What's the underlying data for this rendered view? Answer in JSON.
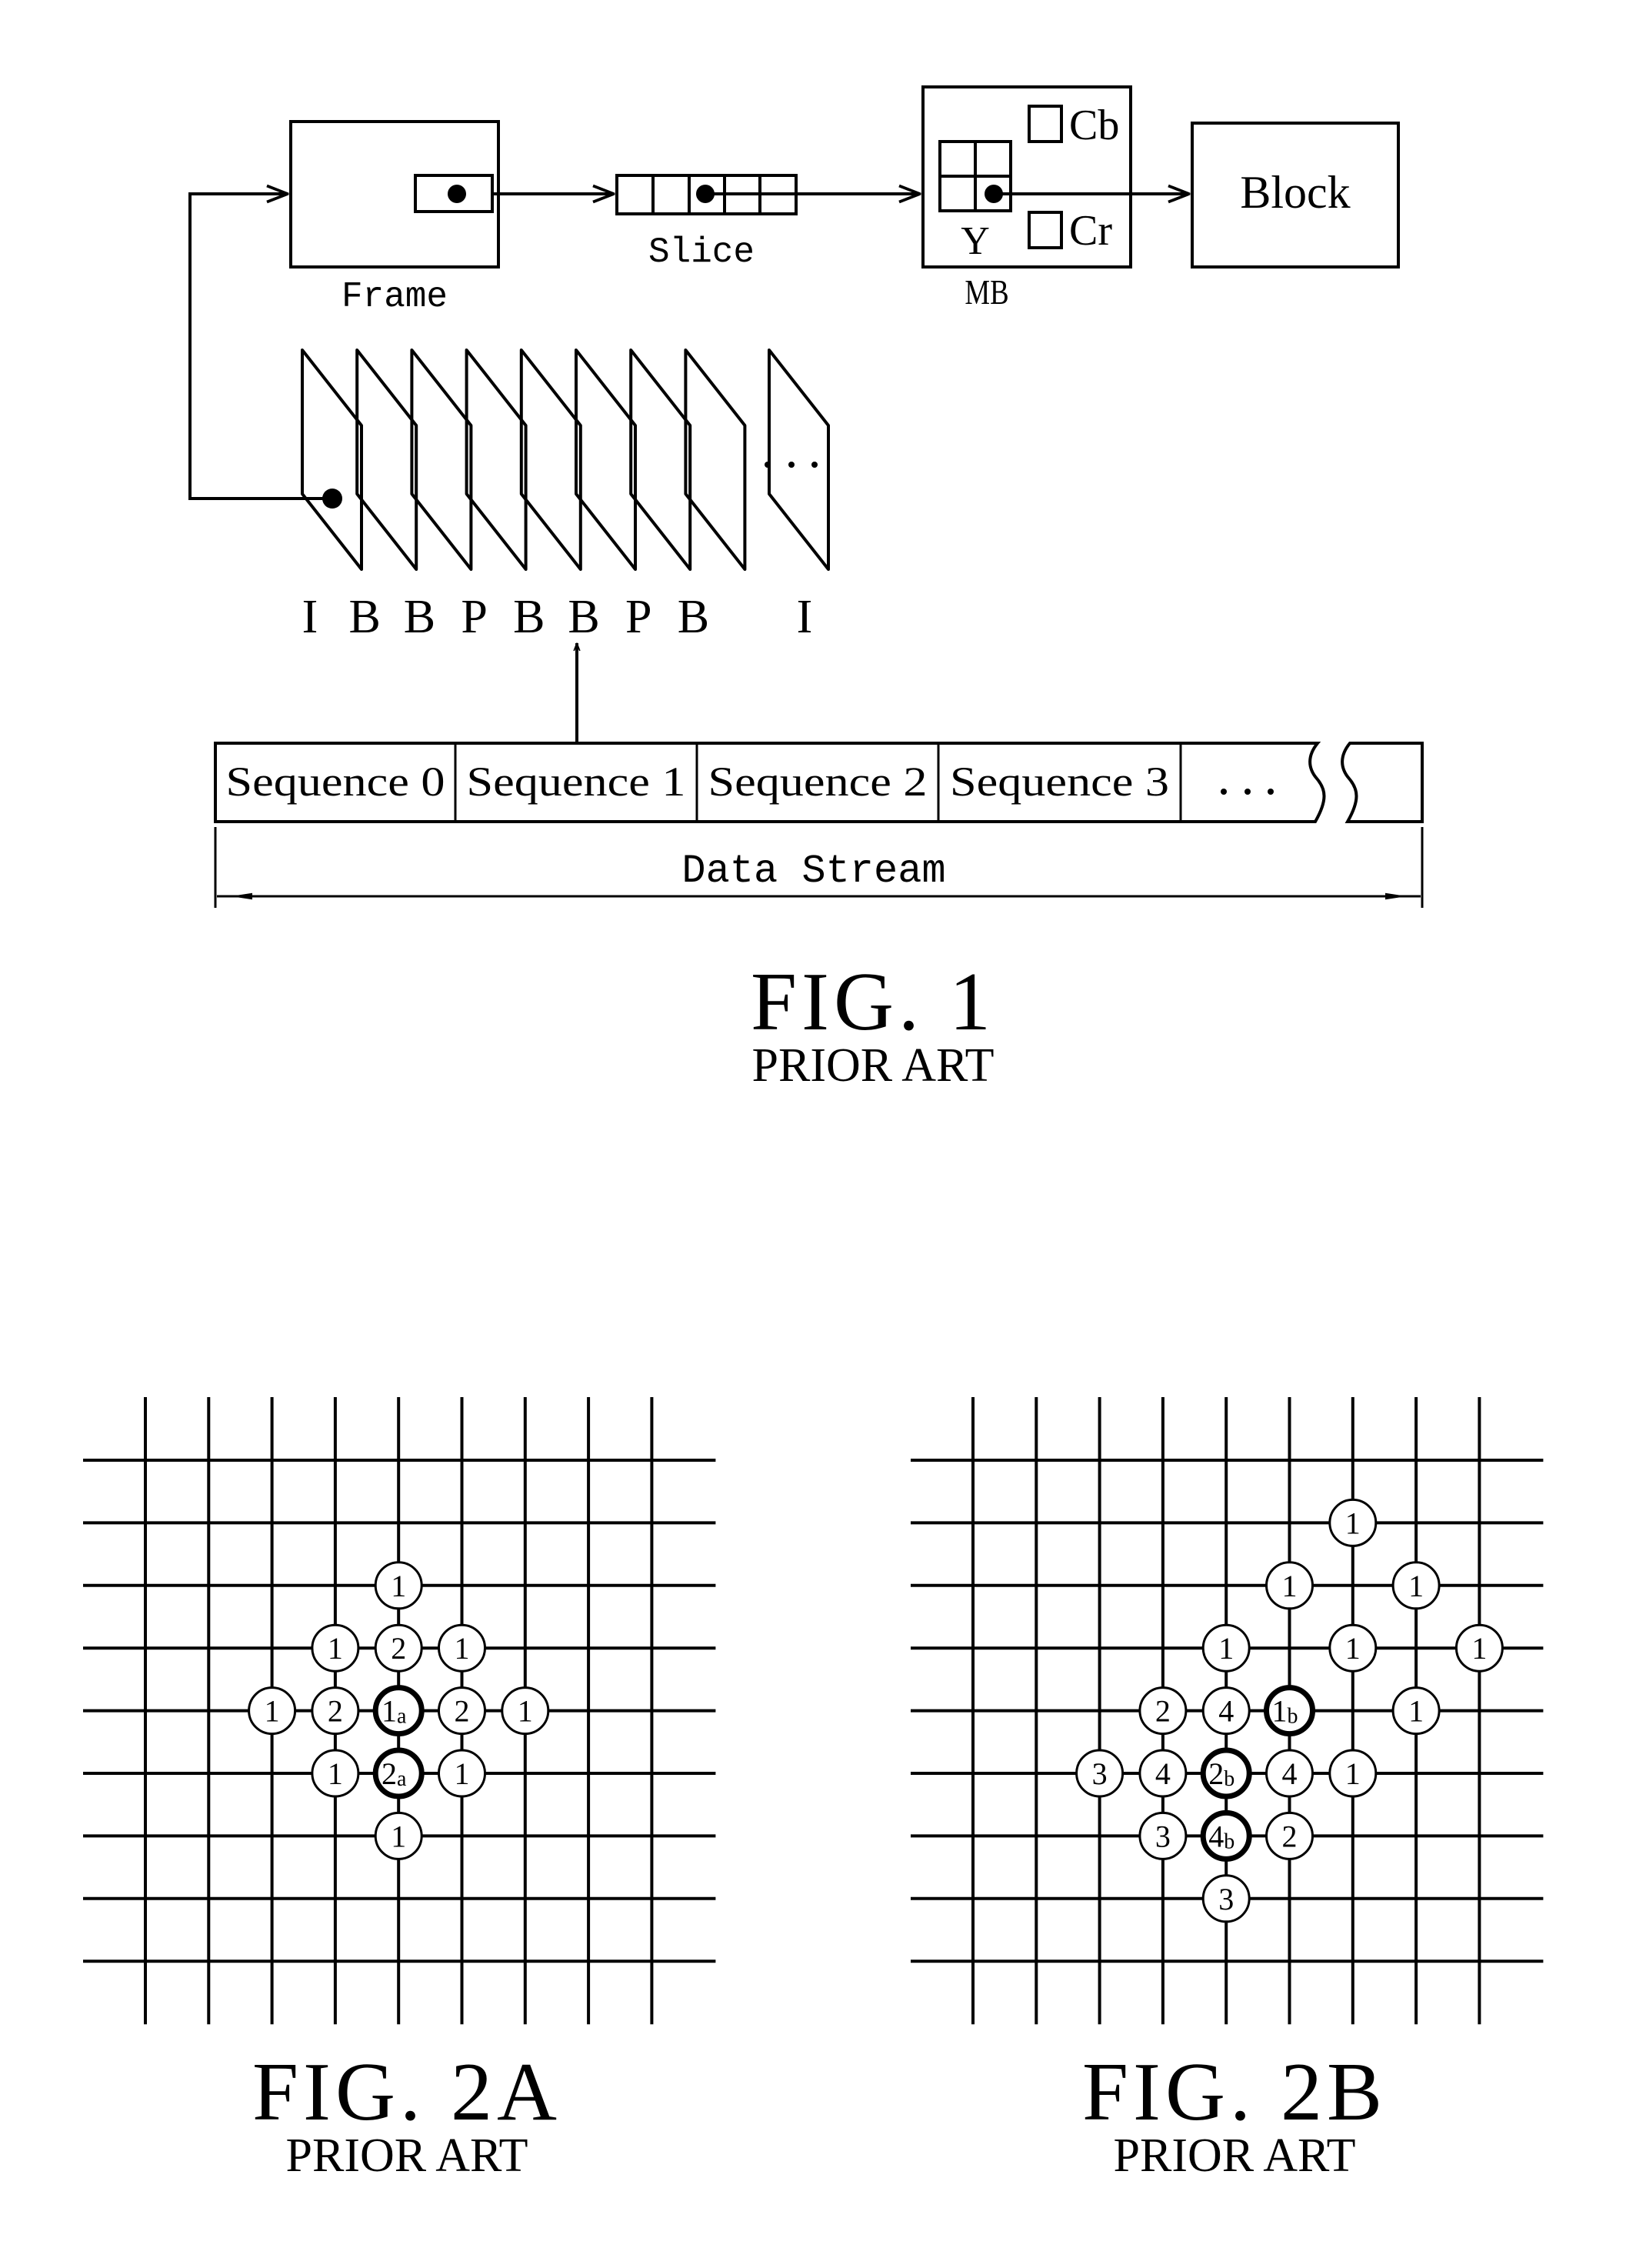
{
  "fig1": {
    "frame_label": "Frame",
    "slice_label": "Slice",
    "mb_label": "MB",
    "mb_y_label": "Y",
    "mb_cb_label": "Cb",
    "mb_cr_label": "Cr",
    "block_label": "Block",
    "picture_types": [
      "I",
      "B",
      "B",
      "P",
      "B",
      "B",
      "P",
      "B"
    ],
    "ellipsis": "...",
    "last_picture_type": "I",
    "sequences": [
      "Sequence 0",
      "Sequence 1",
      "Sequence 2",
      "Sequence 3"
    ],
    "sequence_ellipsis": "...",
    "data_stream_label": "Data Stream",
    "caption": "FIG. 1",
    "subcaption": "PRIOR ART"
  },
  "fig2a": {
    "grid_columns": 9,
    "grid_rows": 9,
    "nodes": [
      {
        "col": 4,
        "row": 2,
        "num": "1",
        "sub": "",
        "bold": false
      },
      {
        "col": 3,
        "row": 3,
        "num": "1",
        "sub": "",
        "bold": false
      },
      {
        "col": 4,
        "row": 3,
        "num": "2",
        "sub": "",
        "bold": false
      },
      {
        "col": 5,
        "row": 3,
        "num": "1",
        "sub": "",
        "bold": false
      },
      {
        "col": 2,
        "row": 4,
        "num": "1",
        "sub": "",
        "bold": false
      },
      {
        "col": 3,
        "row": 4,
        "num": "2",
        "sub": "",
        "bold": false
      },
      {
        "col": 4,
        "row": 4,
        "num": "1",
        "sub": "a",
        "bold": true
      },
      {
        "col": 5,
        "row": 4,
        "num": "2",
        "sub": "",
        "bold": false
      },
      {
        "col": 6,
        "row": 4,
        "num": "1",
        "sub": "",
        "bold": false
      },
      {
        "col": 3,
        "row": 5,
        "num": "1",
        "sub": "",
        "bold": false
      },
      {
        "col": 4,
        "row": 5,
        "num": "2",
        "sub": "a",
        "bold": true
      },
      {
        "col": 5,
        "row": 5,
        "num": "1",
        "sub": "",
        "bold": false
      },
      {
        "col": 4,
        "row": 6,
        "num": "1",
        "sub": "",
        "bold": false
      }
    ],
    "caption": "FIG. 2A",
    "subcaption": "PRIOR ART"
  },
  "fig2b": {
    "grid_columns": 9,
    "grid_rows": 9,
    "nodes": [
      {
        "col": 6,
        "row": 1,
        "num": "1",
        "sub": "",
        "bold": false
      },
      {
        "col": 5,
        "row": 2,
        "num": "1",
        "sub": "",
        "bold": false
      },
      {
        "col": 7,
        "row": 2,
        "num": "1",
        "sub": "",
        "bold": false
      },
      {
        "col": 4,
        "row": 3,
        "num": "1",
        "sub": "",
        "bold": false
      },
      {
        "col": 6,
        "row": 3,
        "num": "1",
        "sub": "",
        "bold": false
      },
      {
        "col": 8,
        "row": 3,
        "num": "1",
        "sub": "",
        "bold": false
      },
      {
        "col": 3,
        "row": 4,
        "num": "2",
        "sub": "",
        "bold": false
      },
      {
        "col": 4,
        "row": 4,
        "num": "4",
        "sub": "",
        "bold": false
      },
      {
        "col": 5,
        "row": 4,
        "num": "1",
        "sub": "b",
        "bold": true
      },
      {
        "col": 7,
        "row": 4,
        "num": "1",
        "sub": "",
        "bold": false
      },
      {
        "col": 2,
        "row": 5,
        "num": "3",
        "sub": "",
        "bold": false
      },
      {
        "col": 3,
        "row": 5,
        "num": "4",
        "sub": "",
        "bold": false
      },
      {
        "col": 4,
        "row": 5,
        "num": "2",
        "sub": "b",
        "bold": true
      },
      {
        "col": 5,
        "row": 5,
        "num": "4",
        "sub": "",
        "bold": false
      },
      {
        "col": 6,
        "row": 5,
        "num": "1",
        "sub": "",
        "bold": false
      },
      {
        "col": 3,
        "row": 6,
        "num": "3",
        "sub": "",
        "bold": false
      },
      {
        "col": 4,
        "row": 6,
        "num": "4",
        "sub": "b",
        "bold": true
      },
      {
        "col": 5,
        "row": 6,
        "num": "2",
        "sub": "",
        "bold": false
      },
      {
        "col": 4,
        "row": 7,
        "num": "3",
        "sub": "",
        "bold": false
      }
    ],
    "caption": "FIG. 2B",
    "subcaption": "PRIOR ART"
  }
}
